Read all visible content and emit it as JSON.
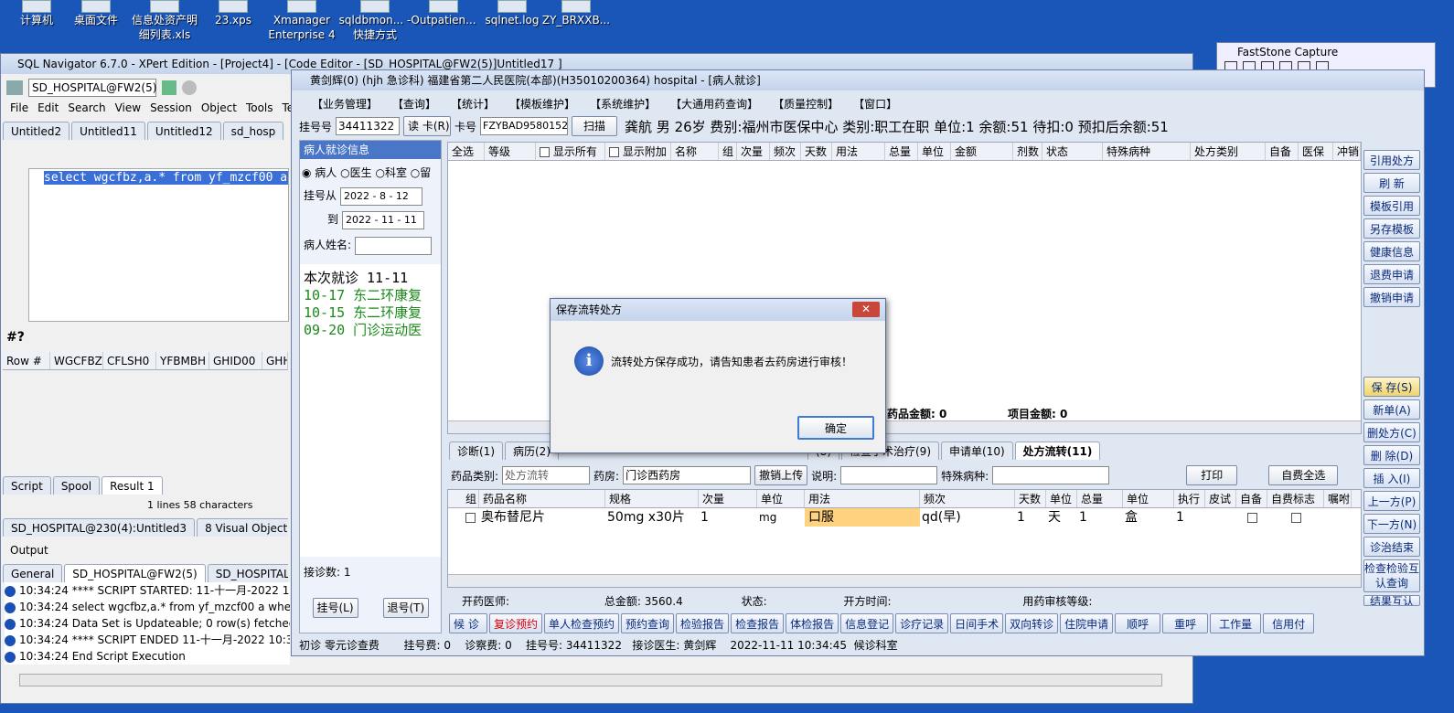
{
  "desktop": {
    "icons": [
      "计算机",
      "桌面文件",
      "信息处资产明细列表.xls",
      "23.xps",
      "Xmanager Enterprise 4",
      "sqldbmon... - 快捷方式",
      "Outpatien...",
      "sqlnet.log",
      "ZY_BRXXB..."
    ]
  },
  "sqlnav": {
    "title": "SQL Navigator 6.7.0 - XPert Edition - [Project4] - [Code Editor - [SD_HOSPITAL@FW2(5)]Untitled17 ]",
    "conn": "SD_HOSPITAL@FW2(5)",
    "menu": [
      "File",
      "Edit",
      "Search",
      "View",
      "Session",
      "Object",
      "Tools",
      "Team"
    ],
    "doc_tabs": [
      "Untitled2",
      "Untitled11",
      "Untitled12",
      "sd_hosp"
    ],
    "sql_text": "select wgcfbz,a.* from yf_mzcf00 a",
    "hash": "#?",
    "grid_cols": [
      "Row #",
      "WGCFBZ",
      "CFLSH0",
      "YFBMBH",
      "GHID00",
      "GHH0"
    ],
    "result_tabs": [
      "Script",
      "Spool",
      "Result 1"
    ],
    "status": "1 lines 58 characters",
    "proj_tabs": [
      "SD_HOSPITAL@230(4):Untitled3",
      "8 Visual Object Editor"
    ],
    "output_title": "Output",
    "output_tabs": [
      "General",
      "SD_HOSPITAL@FW2(5)",
      "SD_HOSPITAL@230(4)"
    ],
    "log": [
      "10:34:24 **** SCRIPT STARTED: 11-十一月-2022 10:34:24 ****",
      "10:34:24 select wgcfbz,a.* from yf_mzcf00 a where ghh000='3",
      "10:34:24 Data Set is Updateable; 0 row(s) fetched",
      "10:34:24 **** SCRIPT ENDED 11-十一月-2022 10:34:24 ****",
      "10:34:24 End Script Execution"
    ]
  },
  "faststone": {
    "title": "FastStone Capture"
  },
  "hospital": {
    "title": "黄剑辉(0) (hjh 急诊科) 福建省第二人民医院(本部)(H35010200364) hospital - [病人就诊]",
    "menu": [
      "【业务管理】",
      "【查询】",
      "【统计】",
      "【模板维护】",
      "【系统维护】",
      "【大通用药查询】",
      "【质量控制】",
      "【窗口】"
    ],
    "reg_label": "挂号号",
    "reg_value": "34411322",
    "read_card": "读 卡(R)",
    "card_label": "卡号",
    "card_value": "FZYBAD9580152",
    "scan": "扫描",
    "patient_info": "龚航 男 26岁 费别:福州市医保中心 类别:职工在职 单位:1 余额:51 待扣:0 预扣后余额:51",
    "left_title": "病人就诊信息",
    "radio": [
      "病人",
      "医生",
      "科室",
      "留"
    ],
    "date_from_label": "挂号从",
    "date_from": "2022 - 8 - 12",
    "date_to_label": "到",
    "date_to": "2022 - 11 - 11",
    "name_label": "病人姓名:",
    "tree": [
      "本次就诊 11-11",
      "10-17 东二环康复",
      "10-15 东二环康复",
      "09-20 门诊运动医"
    ],
    "visit_count": "接诊数: 1",
    "reg_btn": "挂号(L)",
    "unreg_btn": "退号(T)",
    "top_grid": [
      "全选",
      "等级",
      "显示所有",
      "显示附加",
      "名称",
      "组",
      "次量",
      "频次",
      "天数",
      "用法",
      "总量",
      "单位",
      "金额",
      "剂数",
      "状态",
      "特殊病种",
      "处方类别",
      "自备",
      "医保",
      "冲销"
    ],
    "drug_total": "药品金额: 0",
    "item_total": "项目金额: 0",
    "bottom_tabs": [
      "诊断(1)",
      "病历(2)",
      "(8)",
      "检查手术治疗(9)",
      "申请单(10)",
      "处方流转(11)"
    ],
    "drug_type_label": "药品类别:",
    "drug_type": "处方流转",
    "pharmacy_label": "药房:",
    "pharmacy": "门诊西药房",
    "cancel_upload": "撤销上传",
    "note_label": "说明:",
    "disease_label": "特殊病种:",
    "print": "打印",
    "select_all": "自费全选",
    "rx_cols": [
      "组",
      "药品名称",
      "规格",
      "次量",
      "单位",
      "用法",
      "频次",
      "天数",
      "单位",
      "总量",
      "单位",
      "执行",
      "皮试",
      "自备",
      "自费标志",
      "嘱咐"
    ],
    "rx_row": {
      "name": "奥布替尼片",
      "spec": "50mg x30片",
      "dose": "1",
      "unit": "mg",
      "usage": "口服",
      "freq": "qd(早)",
      "days": "1",
      "dunit": "天",
      "total": "1",
      "tunit": "盒",
      "exec": "1"
    },
    "info": {
      "doctor": "开药医师:",
      "amount": "总金额: 3560.4",
      "state": "状态:",
      "time": "开方时间:",
      "level": "用药审核等级:"
    },
    "bottom_btns": [
      "候 诊",
      "复诊预约",
      "单人检查预约",
      "预约查询",
      "检验报告",
      "检查报告",
      "体检报告",
      "信息登记",
      "诊疗记录",
      "日间手术",
      "双向转诊",
      "住院申请",
      "顺呼",
      "重呼",
      "工作量",
      "信用付"
    ],
    "status_bar": "初诊 零元诊查费       挂号费: 0    诊察费: 0    挂号号: 34411322   接诊医生: 黄剑辉    2022-11-11 10:34:45  候诊科室",
    "right_btns": [
      "引用处方",
      "刷 新",
      "模板引用",
      "另存模板",
      "健康信息",
      "退费申请",
      "撤销申请",
      "保 存(S)",
      "新单(A)",
      "删处方(C)",
      "删 除(D)",
      "插 入(I)",
      "上一方(P)",
      "下一方(N)",
      "诊治结束",
      "检查检验互认查询",
      "结果互认"
    ]
  },
  "dialog": {
    "title": "保存流转处方",
    "message": "流转处方保存成功，请告知患者去药房进行审核！",
    "ok": "确定"
  }
}
